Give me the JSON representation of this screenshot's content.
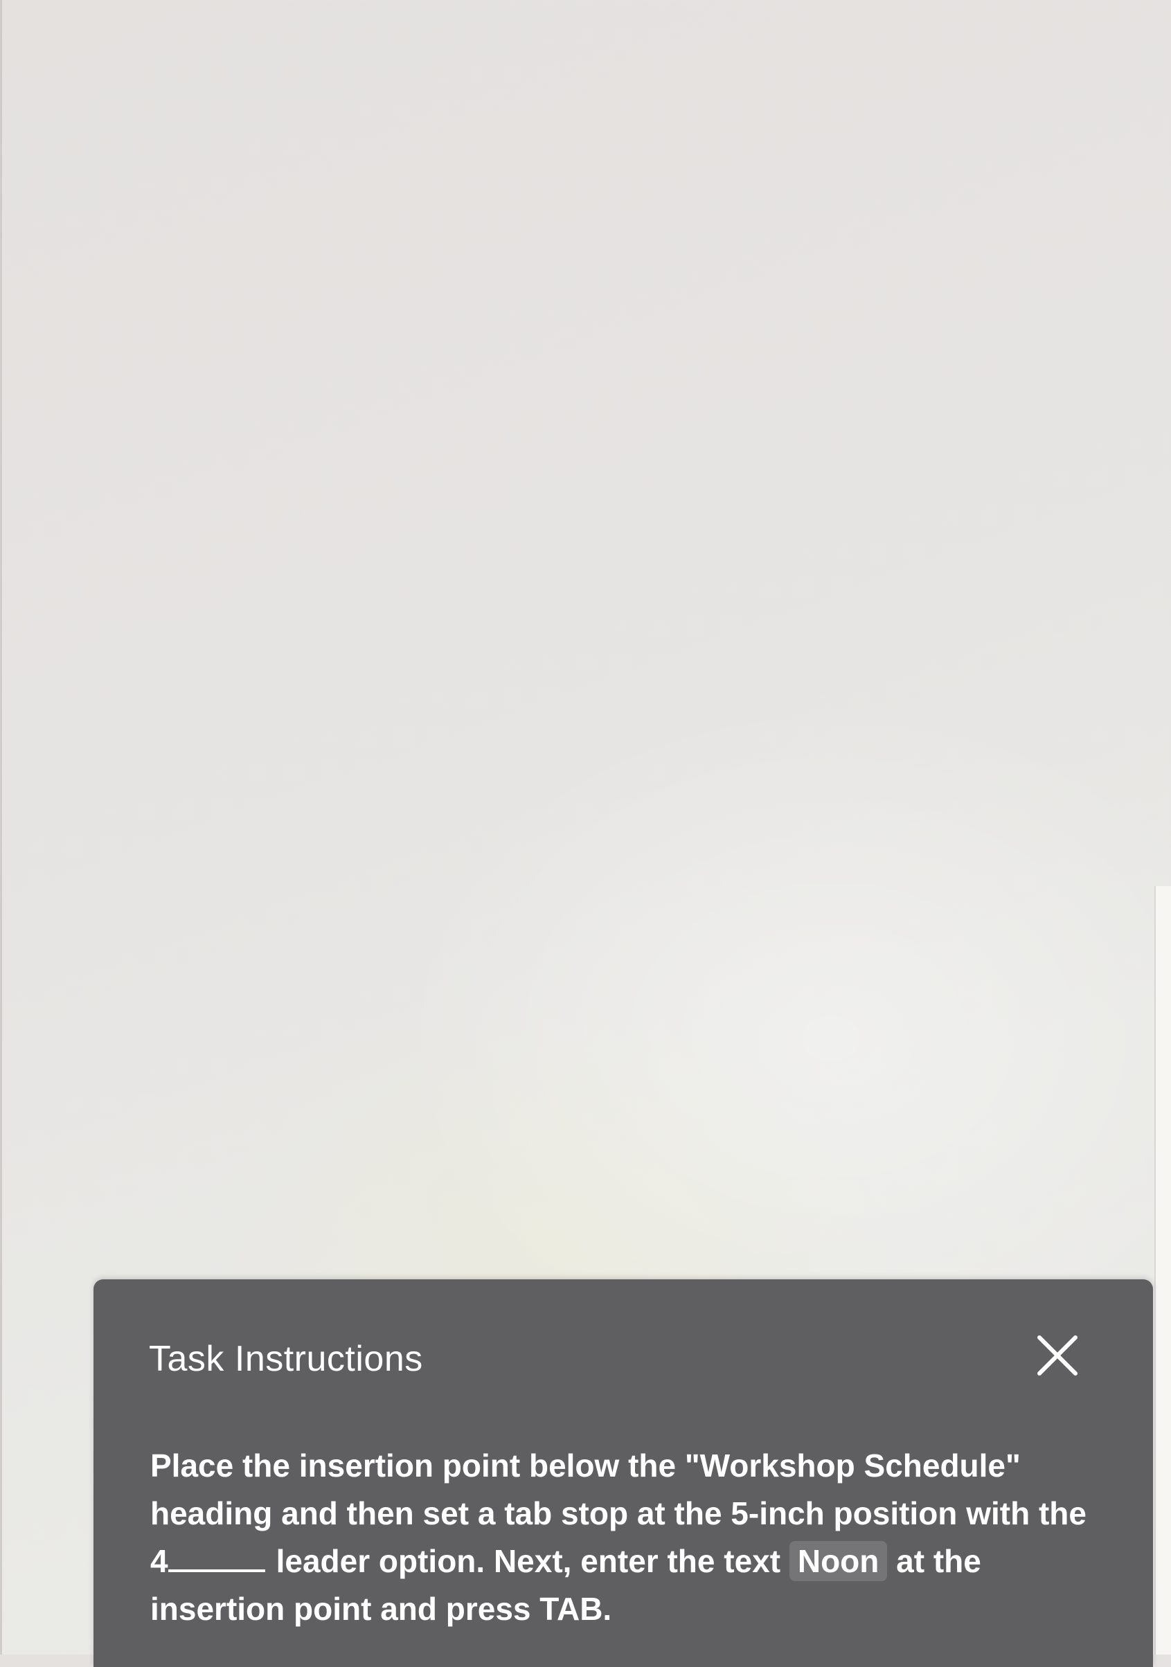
{
  "task_panel": {
    "title": "Task Instructions",
    "close_icon": "close-icon",
    "body": {
      "part1": "Place the insertion point below the \"Workshop Schedule\" heading and then set a tab stop at the 5-inch position with the 4",
      "part2": "leader option. Next, enter the text ",
      "highlight": "Noon",
      "part3": " at the insertion point and press TAB."
    }
  },
  "colors": {
    "panel_background": "#5f5f61",
    "document_background": "#e6e4e2",
    "highlight_background": "#757577"
  }
}
